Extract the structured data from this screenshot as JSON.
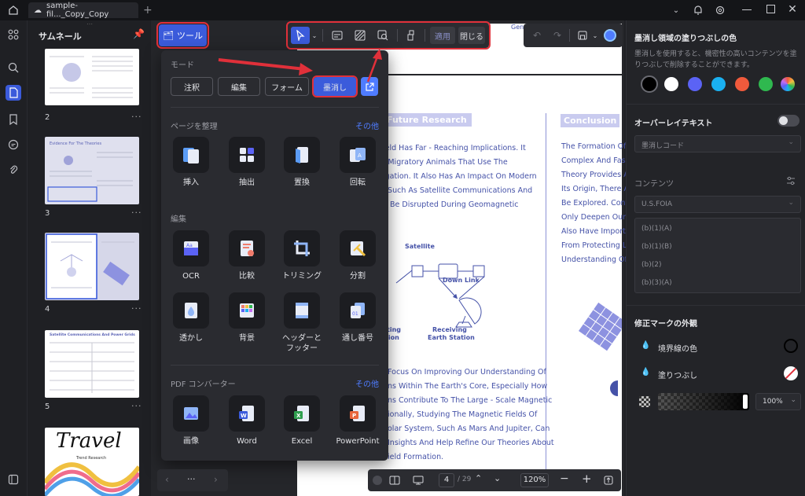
{
  "titlebar": {
    "tab_title": "sample-fil..._Copy_Copy",
    "new_tab": "+"
  },
  "thumbnails": {
    "title": "サムネール",
    "pages": [
      {
        "number": "2"
      },
      {
        "number": "3",
        "heading": "Evidence For The Theories"
      },
      {
        "number": "4"
      },
      {
        "number": "5",
        "heading": "Satellite Communications And Power Grids"
      },
      {
        "number": "",
        "script": "Travel",
        "subtitle": "Trend Research"
      }
    ],
    "more": "···"
  },
  "toolbar": {
    "tools_label": "ツール",
    "apply_label": "適用",
    "close_label": "閉じる"
  },
  "menu": {
    "mode_title": "モード",
    "modes": [
      "注釈",
      "編集",
      "フォーム",
      "墨消し"
    ],
    "organize_title": "ページを整理",
    "more_label": "その他",
    "organize_tools": [
      "挿入",
      "抽出",
      "置換",
      "回転"
    ],
    "edit_title": "編集",
    "edit_tools": [
      "OCR",
      "比較",
      "トリミング",
      "分割",
      "透かし",
      "背景",
      "ヘッダーと フッター",
      "通し番号"
    ],
    "converter_title": "PDF コンバーター",
    "converter_tools": [
      "画像",
      "Word",
      "Excel",
      "PowerPoint"
    ]
  },
  "document": {
    "header_fragment": "Gene",
    "left_heading": "Future Research",
    "left_lines": [
      "ield Has Far - Reaching Implications. It",
      "f Migratory Animals That Use The",
      "igation. It Also Has An Impact On Modern",
      ", Such As Satellite Communications And",
      "n Be Disrupted During Geomagnetic"
    ],
    "diagram": {
      "satellite": "Satellite",
      "downlink": "Down Link",
      "receiving": "Receiving",
      "earth_station": "Earth Station",
      "left_frag1": "ting",
      "left_frag2": "tion"
    },
    "left_lines2": [
      "Focus On Improving Our Understanding Of",
      "ns Within The Earth's Core, Especially How",
      "ns Contribute To The Large - Scale Magnetic",
      "ionally, Studying The Magnetic Fields Of",
      "olar System, Such As Mars And Jupiter, Can",
      "Insights And Help Refine Our Theories About",
      "ield Formation."
    ],
    "right_heading": "Conclusion",
    "right_lines": [
      "The Formation Of The",
      "Complex And Fascina",
      "Theory Provides A Ro",
      "Its Origin, There Are",
      "Be Explored. Continu",
      "Only Deepen Our Kno",
      "Also Have Important I",
      "From Protecting Life",
      "Understanding Of The"
    ]
  },
  "right_panel": {
    "fill_title": "墨消し領域の塗りつぶしの色",
    "fill_desc": "墨消しを使用すると、機密性の高いコンテンツを塗りつぶしで削除することができます。",
    "colors": [
      "#000000",
      "#ffffff",
      "#5b63f5",
      "#1ab0f0",
      "#f05a3c",
      "#2fb84f",
      "rainbow"
    ],
    "overlay_title": "オーバーレイテキスト",
    "overlay_placeholder": "墨消しコード",
    "contents_title": "コンテンツ",
    "contents_select": "U.S.FOIA",
    "contents_items": [
      "(b)(1)(A)",
      "(b)(1)(B)",
      "(b)(2)",
      "(b)(3)(A)"
    ],
    "appearance_title": "修正マークの外観",
    "border_color_label": "境界線の色",
    "fill_label": "塗りつぶし",
    "opacity_value": "100%"
  },
  "pagebar": {
    "current_page": "4",
    "total_pages": "/ 29",
    "zoom": "120%"
  },
  "navbar": {
    "more": "···"
  }
}
